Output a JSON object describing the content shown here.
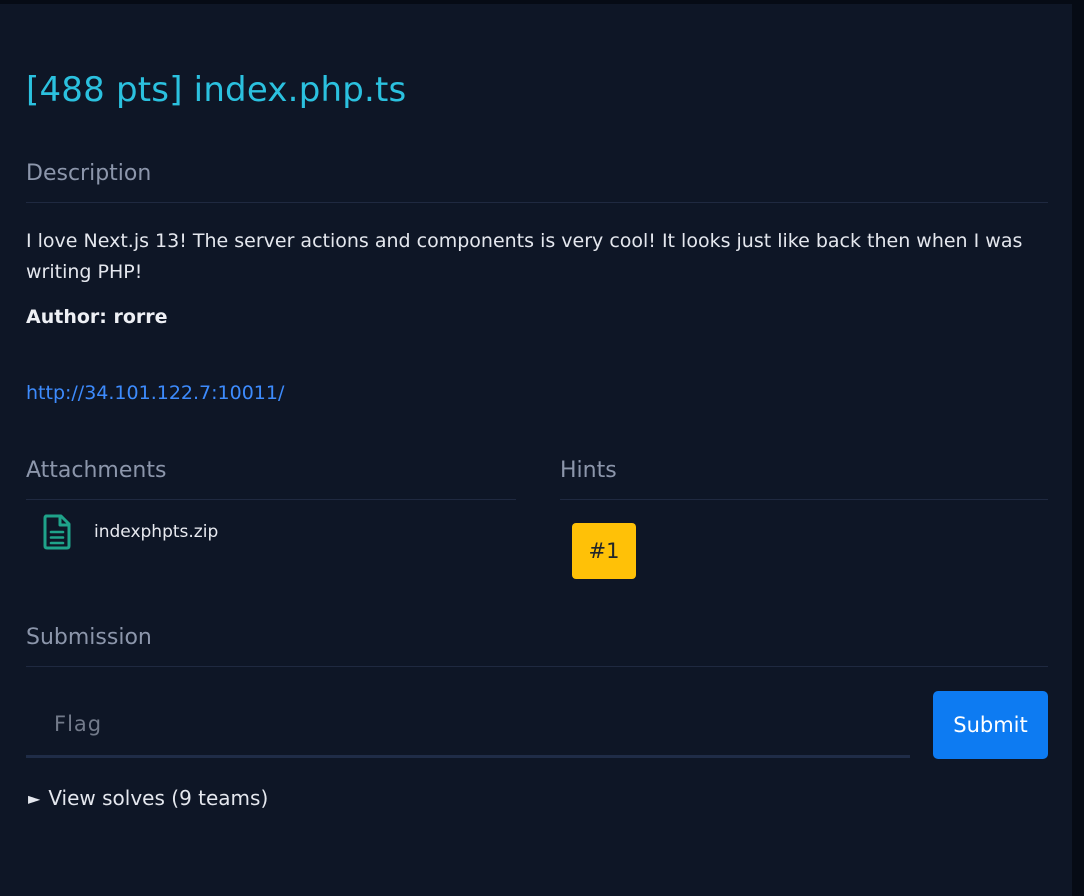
{
  "challenge": {
    "title": "[488 pts] index.php.ts",
    "description_heading": "Description",
    "description": "I love Next.js 13! The server actions and components is very cool! It looks just like back then when I was writing PHP!",
    "author": "Author: rorre",
    "link": "http://34.101.122.7:10011/"
  },
  "attachments": {
    "heading": "Attachments",
    "items": [
      {
        "icon": "file-text-icon",
        "name": "indexphpts.zip"
      }
    ]
  },
  "hints": {
    "heading": "Hints",
    "items": [
      {
        "label": "#1"
      }
    ]
  },
  "submission": {
    "heading": "Submission",
    "flag_placeholder": "Flag",
    "flag_value": "",
    "submit_label": "Submit"
  },
  "solves": {
    "toggle_icon": "triangle-right-icon",
    "label": "View solves (9 teams)"
  },
  "colors": {
    "title": "#2bc1df",
    "link": "#3d8bfd",
    "hint_button": "#ffc107",
    "submit_button": "#0d7bf2",
    "file_icon": "#1fa38a",
    "background": "#0e1626"
  }
}
